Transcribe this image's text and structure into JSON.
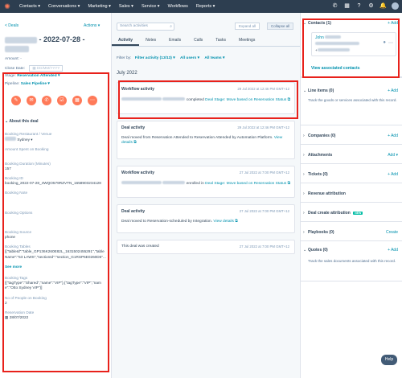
{
  "topnav": {
    "items": [
      "Contacts ▾",
      "Conversations ▾",
      "Marketing ▾",
      "Sales ▾",
      "Service ▾",
      "Workflows",
      "Reports ▾"
    ]
  },
  "left": {
    "back_label": "< Deals",
    "actions_label": "Actions ▾",
    "title_suffix": "- 2022-07-28 -",
    "amount_label": "Amount: -",
    "close_date_label": "Close Date:",
    "close_date_placeholder": "DD/MM/YYYY",
    "stage_label": "Stage:",
    "stage_value": "Reservation Attended ▾",
    "pipeline_label": "Pipeline:",
    "pipeline_value": "Sales Pipeline ▾",
    "about_label": "About this deal",
    "properties": [
      {
        "label": "Booking Restaurant / Venue",
        "value": "Sydney ▾"
      },
      {
        "label": "Amount Spent on Booking",
        "value": ""
      },
      {
        "label": "Booking Duration (Minutes)",
        "value": "157"
      },
      {
        "label": "Booking ID",
        "value": "booking_2022-07-28_4WQO579RZVTN_1658903234128"
      },
      {
        "label": "Booking Note",
        "value": ""
      },
      {
        "label": "Booking Options",
        "value": ""
      },
      {
        "label": "Booking Source",
        "value": "phone"
      },
      {
        "label": "Booking Tables",
        "value": "[{\"tableId\":\"table_GP136K260E82L_1631502455291\",\"tableName\":\"53 LAWS\",\"sectionId\":\"section_G1RSP6E0260D5\"..."
      },
      {
        "label": "Booking Tags",
        "value": "[{\"tagType\":\"Shared\",\"name\":\"VIP\"},{\"tagType\":\"VIP\",\"name\":\"Otto Sydney VIP\"}]"
      },
      {
        "label": "No of People on Booking",
        "value": "2"
      },
      {
        "label": "Reservation Date",
        "value": "28/07/2022"
      }
    ],
    "see_more": "See more"
  },
  "middle": {
    "search_placeholder": "Search activities",
    "expand_all": "Expand all",
    "collapse_all": "Collapse all",
    "tabs": [
      "Activity",
      "Notes",
      "Emails",
      "Calls",
      "Tasks",
      "Meetings"
    ],
    "filter_label": "Filter by:",
    "filter_activity": "Filter activity (13/13) ▾",
    "filter_users": "All users ▾",
    "filter_teams": "All teams ▾",
    "month": "July 2022",
    "cards": [
      {
        "title": "Workflow activity",
        "date": "29 Jul 2022 at 12:46 PM GMT+12",
        "text": "completed",
        "link": "Deal Stage: Move based on Reservation Status ⧉",
        "extra": ""
      },
      {
        "title": "Deal activity",
        "date": "29 Jul 2022 at 12:46 PM GMT+12",
        "text": "Deal moved from Reservation Attended to Reservation Attended by Automation Platform.",
        "link": "View details ⧉",
        "extra": ""
      },
      {
        "title": "Workflow activity",
        "date": "27 Jul 2022 at 7:00 PM GMT+12",
        "text": "enrolled in",
        "link": "Deal Stage: Move based on Reservation Status ⧉",
        "extra": ""
      },
      {
        "title": "Deal activity",
        "date": "27 Jul 2022 at 7:00 PM GMT+12",
        "text": "Deal moved to Reservation-scheduled by Integration.",
        "link": "View details ⧉",
        "extra": ""
      },
      {
        "title": "This deal was created",
        "date": "27 Jul 2022 at 7:00 PM GMT+12",
        "text": "",
        "link": "",
        "extra": ""
      }
    ]
  },
  "right": {
    "contacts_label": "Contacts (1)",
    "add_label": "+ Add",
    "contact_name": "John",
    "view_contacts": "View associated contacts",
    "line_items_label": "Line items (0)",
    "line_items_text": "Track the goods or services associated with this record.",
    "companies_label": "Companies (0)",
    "attachments_label": "Attachments",
    "attachments_add": "Add ▾",
    "tickets_label": "Tickets (0)",
    "revenue_label": "Revenue attribution",
    "deal_create_label": "Deal create attribution",
    "new_badge": "NEW",
    "playbooks_label": "Playbooks (0)",
    "create_label": "Create",
    "quotes_label": "Quotes (0)",
    "quotes_text": "Track the sales documents associated with this record.",
    "help_label": "Help"
  }
}
